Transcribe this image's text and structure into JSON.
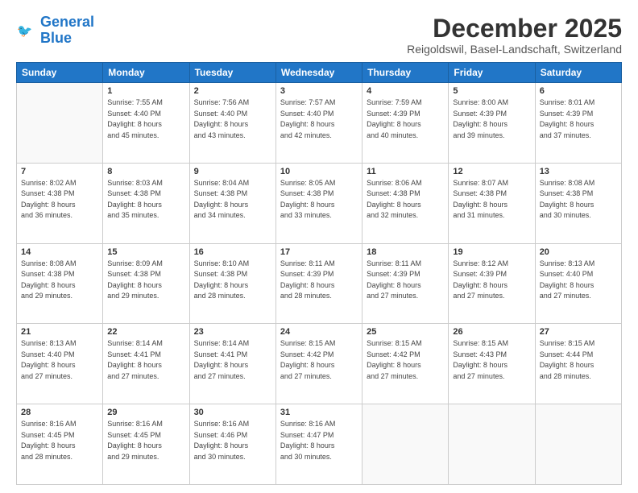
{
  "logo": {
    "line1": "General",
    "line2": "Blue"
  },
  "title": "December 2025",
  "subtitle": "Reigoldswil, Basel-Landschaft, Switzerland",
  "weekdays": [
    "Sunday",
    "Monday",
    "Tuesday",
    "Wednesday",
    "Thursday",
    "Friday",
    "Saturday"
  ],
  "weeks": [
    [
      {
        "day": "",
        "info": ""
      },
      {
        "day": "1",
        "info": "Sunrise: 7:55 AM\nSunset: 4:40 PM\nDaylight: 8 hours\nand 45 minutes."
      },
      {
        "day": "2",
        "info": "Sunrise: 7:56 AM\nSunset: 4:40 PM\nDaylight: 8 hours\nand 43 minutes."
      },
      {
        "day": "3",
        "info": "Sunrise: 7:57 AM\nSunset: 4:40 PM\nDaylight: 8 hours\nand 42 minutes."
      },
      {
        "day": "4",
        "info": "Sunrise: 7:59 AM\nSunset: 4:39 PM\nDaylight: 8 hours\nand 40 minutes."
      },
      {
        "day": "5",
        "info": "Sunrise: 8:00 AM\nSunset: 4:39 PM\nDaylight: 8 hours\nand 39 minutes."
      },
      {
        "day": "6",
        "info": "Sunrise: 8:01 AM\nSunset: 4:39 PM\nDaylight: 8 hours\nand 37 minutes."
      }
    ],
    [
      {
        "day": "7",
        "info": "Sunrise: 8:02 AM\nSunset: 4:38 PM\nDaylight: 8 hours\nand 36 minutes."
      },
      {
        "day": "8",
        "info": "Sunrise: 8:03 AM\nSunset: 4:38 PM\nDaylight: 8 hours\nand 35 minutes."
      },
      {
        "day": "9",
        "info": "Sunrise: 8:04 AM\nSunset: 4:38 PM\nDaylight: 8 hours\nand 34 minutes."
      },
      {
        "day": "10",
        "info": "Sunrise: 8:05 AM\nSunset: 4:38 PM\nDaylight: 8 hours\nand 33 minutes."
      },
      {
        "day": "11",
        "info": "Sunrise: 8:06 AM\nSunset: 4:38 PM\nDaylight: 8 hours\nand 32 minutes."
      },
      {
        "day": "12",
        "info": "Sunrise: 8:07 AM\nSunset: 4:38 PM\nDaylight: 8 hours\nand 31 minutes."
      },
      {
        "day": "13",
        "info": "Sunrise: 8:08 AM\nSunset: 4:38 PM\nDaylight: 8 hours\nand 30 minutes."
      }
    ],
    [
      {
        "day": "14",
        "info": "Sunrise: 8:08 AM\nSunset: 4:38 PM\nDaylight: 8 hours\nand 29 minutes."
      },
      {
        "day": "15",
        "info": "Sunrise: 8:09 AM\nSunset: 4:38 PM\nDaylight: 8 hours\nand 29 minutes."
      },
      {
        "day": "16",
        "info": "Sunrise: 8:10 AM\nSunset: 4:38 PM\nDaylight: 8 hours\nand 28 minutes."
      },
      {
        "day": "17",
        "info": "Sunrise: 8:11 AM\nSunset: 4:39 PM\nDaylight: 8 hours\nand 28 minutes."
      },
      {
        "day": "18",
        "info": "Sunrise: 8:11 AM\nSunset: 4:39 PM\nDaylight: 8 hours\nand 27 minutes."
      },
      {
        "day": "19",
        "info": "Sunrise: 8:12 AM\nSunset: 4:39 PM\nDaylight: 8 hours\nand 27 minutes."
      },
      {
        "day": "20",
        "info": "Sunrise: 8:13 AM\nSunset: 4:40 PM\nDaylight: 8 hours\nand 27 minutes."
      }
    ],
    [
      {
        "day": "21",
        "info": "Sunrise: 8:13 AM\nSunset: 4:40 PM\nDaylight: 8 hours\nand 27 minutes."
      },
      {
        "day": "22",
        "info": "Sunrise: 8:14 AM\nSunset: 4:41 PM\nDaylight: 8 hours\nand 27 minutes."
      },
      {
        "day": "23",
        "info": "Sunrise: 8:14 AM\nSunset: 4:41 PM\nDaylight: 8 hours\nand 27 minutes."
      },
      {
        "day": "24",
        "info": "Sunrise: 8:15 AM\nSunset: 4:42 PM\nDaylight: 8 hours\nand 27 minutes."
      },
      {
        "day": "25",
        "info": "Sunrise: 8:15 AM\nSunset: 4:42 PM\nDaylight: 8 hours\nand 27 minutes."
      },
      {
        "day": "26",
        "info": "Sunrise: 8:15 AM\nSunset: 4:43 PM\nDaylight: 8 hours\nand 27 minutes."
      },
      {
        "day": "27",
        "info": "Sunrise: 8:15 AM\nSunset: 4:44 PM\nDaylight: 8 hours\nand 28 minutes."
      }
    ],
    [
      {
        "day": "28",
        "info": "Sunrise: 8:16 AM\nSunset: 4:45 PM\nDaylight: 8 hours\nand 28 minutes."
      },
      {
        "day": "29",
        "info": "Sunrise: 8:16 AM\nSunset: 4:45 PM\nDaylight: 8 hours\nand 29 minutes."
      },
      {
        "day": "30",
        "info": "Sunrise: 8:16 AM\nSunset: 4:46 PM\nDaylight: 8 hours\nand 30 minutes."
      },
      {
        "day": "31",
        "info": "Sunrise: 8:16 AM\nSunset: 4:47 PM\nDaylight: 8 hours\nand 30 minutes."
      },
      {
        "day": "",
        "info": ""
      },
      {
        "day": "",
        "info": ""
      },
      {
        "day": "",
        "info": ""
      }
    ]
  ]
}
